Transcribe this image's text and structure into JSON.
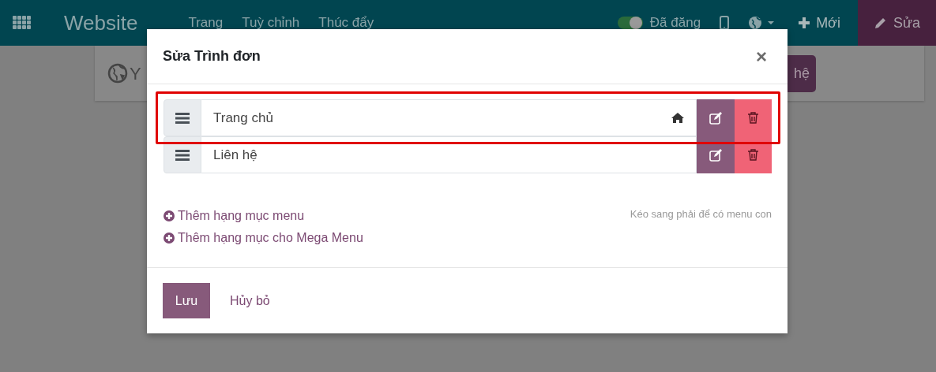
{
  "navbar": {
    "brand": "Website",
    "menus": [
      "Trang",
      "Tuỳ chỉnh",
      "Thúc đẩy"
    ],
    "published": {
      "label": "Đã đăng",
      "on": true
    },
    "new_label": "Mới",
    "edit_label": "Sửa"
  },
  "site_header": {
    "logo_text": "Y",
    "contact_button": "hệ"
  },
  "dialog": {
    "title": "Sửa Trình đơn",
    "close": "×",
    "menu_items": [
      {
        "label": "Trang chủ",
        "home": true,
        "highlighted": true
      },
      {
        "label": "Liên hệ",
        "home": false,
        "highlighted": false
      }
    ],
    "add_links": [
      "Thêm hạng mục menu",
      "Thêm hạng mục cho Mega Menu"
    ],
    "hint": "Kéo sang phải để có menu con",
    "save": "Lưu",
    "cancel": "Hủy bỏ"
  }
}
